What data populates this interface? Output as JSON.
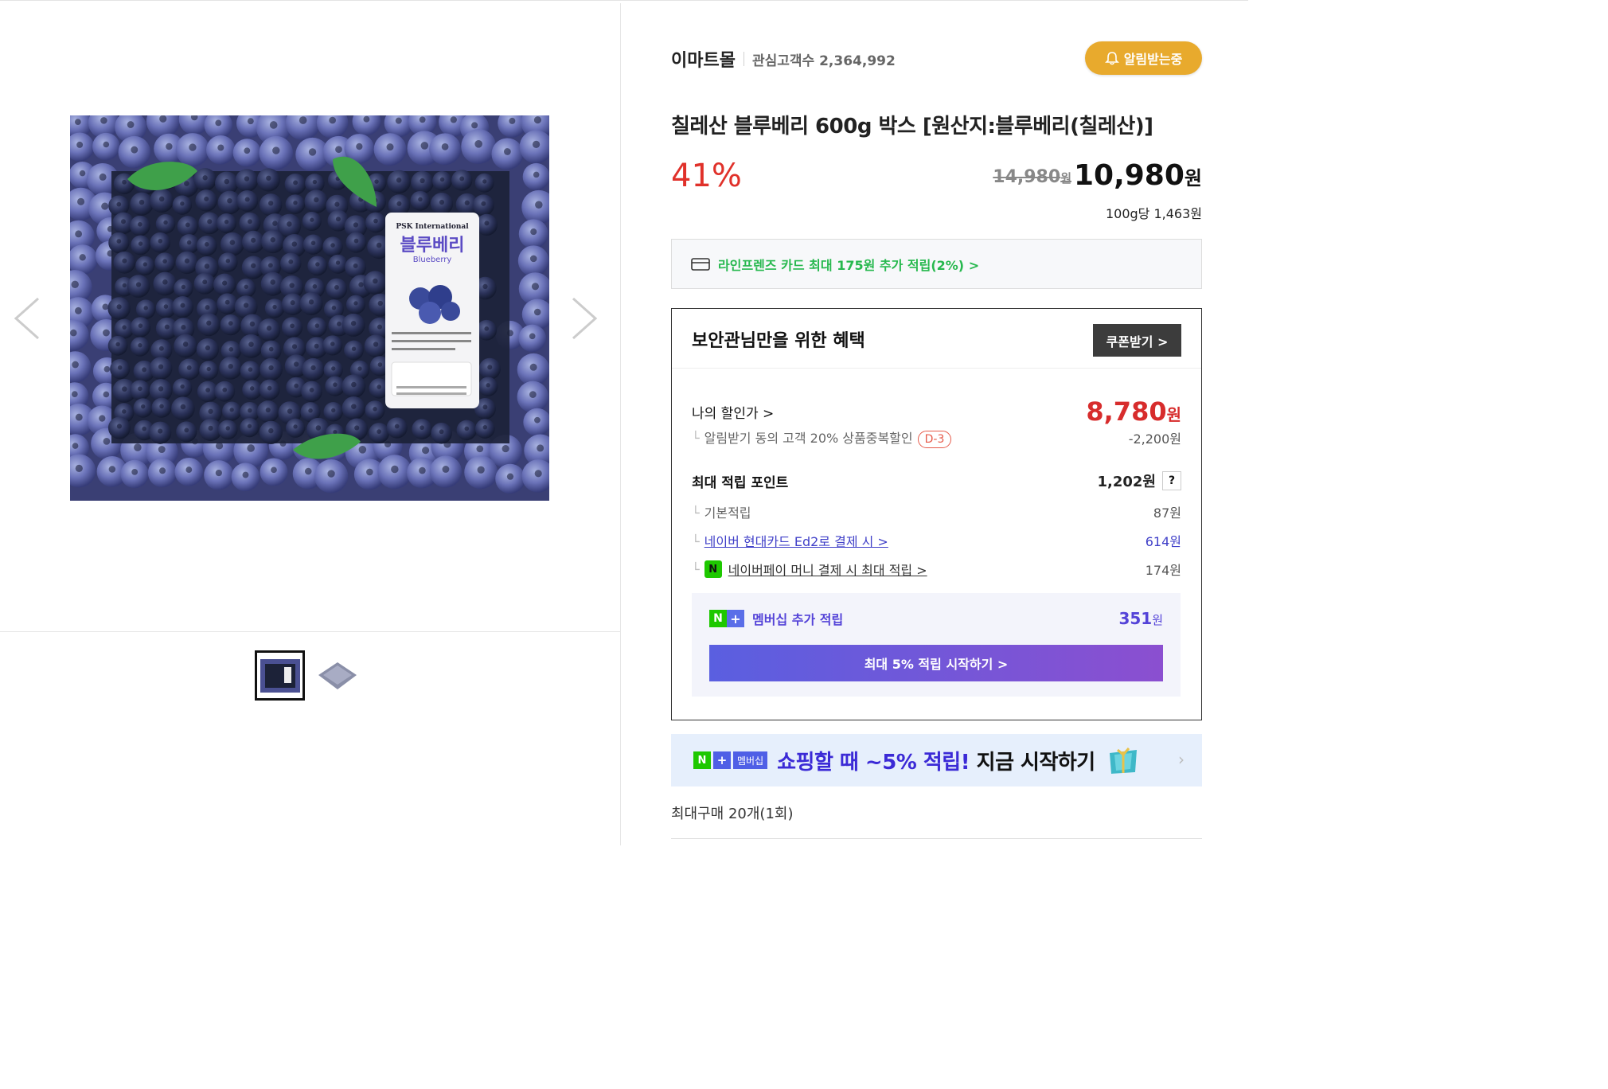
{
  "store": {
    "name": "이마트몰",
    "fans_label": "관심고객수 2,364,992"
  },
  "alarm_button": "알림받는중",
  "product": {
    "title": "칠레산 블루베리 600g 박스 [원산지:블루베리(칠레산)]",
    "discount": "41%",
    "original_price": "14,980",
    "sale_price": "10,980",
    "currency": "원",
    "unit_price": "100g당 1,463원",
    "package_label": {
      "brand": "PSK International",
      "name": "블루베리",
      "name_en": "Blueberry"
    }
  },
  "card_benefit": "라인프렌즈 카드 최대 175원 추가 적립(2%) >",
  "benefit": {
    "title": "보안관님만을 위한 혜택",
    "coupon_button": "쿠폰받기 >",
    "my_price_label": "나의 할인가 >",
    "my_price": "8,780",
    "my_price_sub": "알림받기 동의 고객 20% 상품중복할인",
    "my_price_badge": "D-3",
    "my_price_diff": "-2,200원",
    "points_label": "최대 적립 포인트",
    "points_total": "1,202원",
    "points_help": "?",
    "points": [
      {
        "label": "기본적립",
        "value": "87원",
        "style": "plain"
      },
      {
        "label": "네이버 현대카드 Ed2로 결제 시 >",
        "value": "614원",
        "style": "link"
      },
      {
        "label": "네이버페이 머니 결제 시 최대 적립 >",
        "value": "174원",
        "style": "npay"
      }
    ],
    "membership_label": "멤버십 추가 적립",
    "membership_value": "351",
    "membership_button": "최대 5% 적립 시작하기 >"
  },
  "banner": {
    "tag": "멤버십",
    "text_highlight": "쇼핑할 때 ~5% 적립!",
    "text_rest": " 지금 시작하기",
    "arrow": "›"
  },
  "max_purchase": "최대구매 20개(1회)",
  "colors": {
    "discount": "#e0312a",
    "alarm": "#e8aa2d",
    "naver_green": "#1ec800",
    "membership": "#5443d8"
  },
  "icons": [
    "prev-arrow-icon",
    "next-arrow-icon",
    "bell-icon",
    "card-icon",
    "chevron-right-icon",
    "npay-icon",
    "gift-icon"
  ]
}
